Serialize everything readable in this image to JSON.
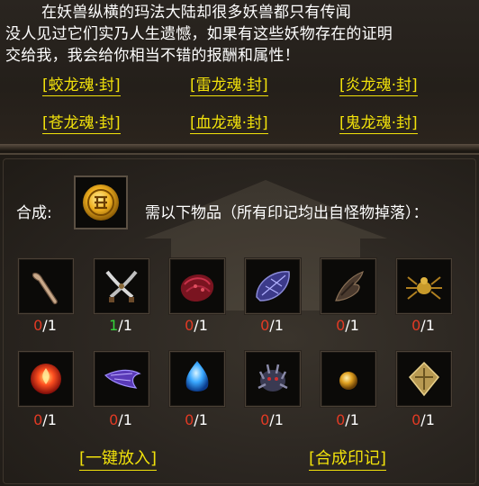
{
  "quest": {
    "lines": [
      "在妖兽纵横的玛法大陆却很多妖兽都只有传闻",
      "没人见过它们实乃人生遗憾，如果有这些妖物存在的证明",
      "交给我，我会给你相当不错的报酬和属性！"
    ],
    "links": [
      "[蛟龙魂·封]",
      "[雷龙魂·封]",
      "[炎龙魂·封]",
      "[苍龙魂·封]",
      "[血龙魂·封]",
      "[鬼龙魂·封]"
    ]
  },
  "synth": {
    "label": "合成:",
    "result_icon": "gold-coin-seal-icon",
    "requirement": "需以下物品（所有印记均出自怪物掉落）："
  },
  "materials": [
    {
      "icon": "bone-club-icon",
      "have": "0",
      "need": "/1"
    },
    {
      "icon": "crossed-blades-icon",
      "have": "1",
      "need": "/1"
    },
    {
      "icon": "red-scale-icon",
      "have": "0",
      "need": "/1"
    },
    {
      "icon": "blue-shell-icon",
      "have": "0",
      "need": "/1"
    },
    {
      "icon": "dark-claw-icon",
      "have": "0",
      "need": "/1"
    },
    {
      "icon": "golden-spider-icon",
      "have": "0",
      "need": "/1"
    },
    {
      "icon": "fire-orb-icon",
      "have": "0",
      "need": "/1"
    },
    {
      "icon": "purple-fin-icon",
      "have": "0",
      "need": "/1"
    },
    {
      "icon": "blue-crystal-icon",
      "have": "0",
      "need": "/1"
    },
    {
      "icon": "spiked-beast-icon",
      "have": "0",
      "need": "/1"
    },
    {
      "icon": "amber-pearl-icon",
      "have": "0",
      "need": "/1"
    },
    {
      "icon": "gold-rune-icon",
      "have": "0",
      "need": "/1"
    }
  ],
  "actions": {
    "put_all": "[一键放入]",
    "synthesize": "[合成印记]"
  },
  "colors": {
    "link": "#f2e20b",
    "missing": "#e23a24",
    "owned": "#35d53a"
  }
}
